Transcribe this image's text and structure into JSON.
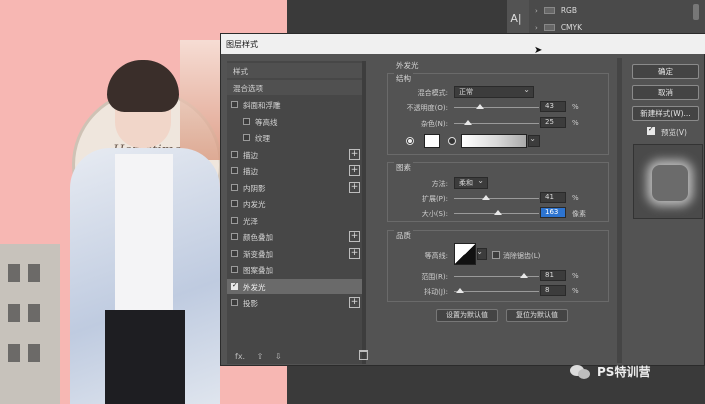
{
  "panels": {
    "channels": [
      {
        "name": "RGB"
      },
      {
        "name": "CMYK"
      }
    ],
    "tool_glyph": "A|"
  },
  "canvas": {
    "clock_text": "Hometime"
  },
  "dialog": {
    "title": "图层样式",
    "left_list": {
      "header_styles": "样式",
      "header_blend": "混合选项",
      "items": [
        {
          "label": "斜面和浮雕",
          "checked": false,
          "plus": false
        },
        {
          "label": "等高线",
          "checked": false,
          "plus": false,
          "sub": true
        },
        {
          "label": "纹理",
          "checked": false,
          "plus": false,
          "sub": true
        },
        {
          "label": "描边",
          "checked": false,
          "plus": true
        },
        {
          "label": "描边",
          "checked": false,
          "plus": true
        },
        {
          "label": "内阴影",
          "checked": false,
          "plus": true
        },
        {
          "label": "内发光",
          "checked": false,
          "plus": false
        },
        {
          "label": "光泽",
          "checked": false,
          "plus": false
        },
        {
          "label": "颜色叠加",
          "checked": false,
          "plus": true
        },
        {
          "label": "渐变叠加",
          "checked": false,
          "plus": true
        },
        {
          "label": "图案叠加",
          "checked": false,
          "plus": false
        },
        {
          "label": "外发光",
          "checked": true,
          "plus": false,
          "selected": true
        },
        {
          "label": "投影",
          "checked": false,
          "plus": true
        }
      ],
      "footer_fx": "fx.",
      "footer_up": "⇧",
      "footer_down": "⇩"
    },
    "outer_glow": {
      "section_title": "外发光",
      "structure": {
        "title": "结构",
        "blend_mode_label": "混合模式:",
        "blend_mode_value": "正常",
        "opacity_label": "不透明度(O):",
        "opacity_value": "43",
        "noise_label": "杂色(N):",
        "noise_value": "25",
        "percent": "%"
      },
      "elements": {
        "title": "图素",
        "method_label": "方法:",
        "method_value": "柔和",
        "spread_label": "扩展(P):",
        "spread_value": "41",
        "size_label": "大小(S):",
        "size_value": "163",
        "size_unit": "像素",
        "percent": "%"
      },
      "quality": {
        "title": "品质",
        "contour_label": "等高线:",
        "anti_alias_label": "消除锯齿(L)",
        "range_label": "范围(R):",
        "range_value": "81",
        "jitter_label": "抖动(J):",
        "jitter_value": "8",
        "percent": "%"
      },
      "make_default": "设置为默认值",
      "reset_default": "复位为默认值"
    },
    "buttons": {
      "ok": "确定",
      "cancel": "取消",
      "new_style": "新建样式(W)...",
      "preview": "预览(V)"
    }
  },
  "watermark": "PS特训营"
}
